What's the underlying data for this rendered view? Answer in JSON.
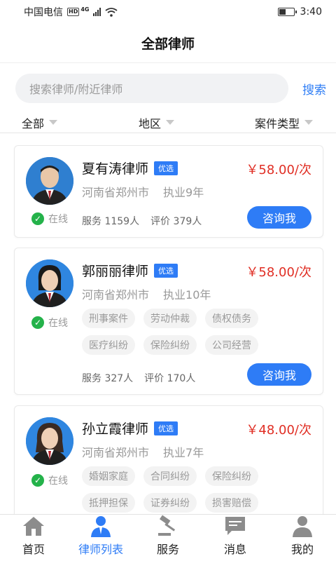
{
  "status": {
    "carrier": "中国电信",
    "hd": "HD",
    "net": "4G",
    "time": "3:40",
    "battery_level": 0.45
  },
  "header": {
    "title": "全部律师"
  },
  "search": {
    "placeholder": "搜索律师/附近律师",
    "button": "搜索"
  },
  "filters": [
    {
      "label": "全部"
    },
    {
      "label": "地区"
    },
    {
      "label": "案件类型"
    }
  ],
  "colors": {
    "accent": "#2e7cf6",
    "price": "#e02e24",
    "online": "#24b24a"
  },
  "lawyers": [
    {
      "name": "夏有涛律师",
      "badge": "优选",
      "price": "￥58.00/次",
      "location": "河南省郑州市",
      "years": "执业9年",
      "status": "在线",
      "service": "服务 1159人",
      "rating": "评价 379人",
      "button": "咨询我",
      "tags": []
    },
    {
      "name": "郭丽丽律师",
      "badge": "优选",
      "price": "￥58.00/次",
      "location": "河南省郑州市",
      "years": "执业10年",
      "status": "在线",
      "service": "服务 327人",
      "rating": "评价 170人",
      "button": "咨询我",
      "tags": [
        "刑事案件",
        "劳动仲裁",
        "债权债务",
        "医疗纠纷",
        "保险纠纷",
        "公司经营"
      ]
    },
    {
      "name": "孙立霞律师",
      "badge": "优选",
      "price": "￥48.00/次",
      "location": "河南省郑州市",
      "years": "执业7年",
      "status": "在线",
      "tags": [
        "婚姻家庭",
        "合同纠纷",
        "保险纠纷",
        "抵押担保",
        "证券纠纷",
        "损害赔偿"
      ]
    }
  ],
  "tabbar": [
    {
      "label": "首页",
      "icon": "home-icon"
    },
    {
      "label": "律师列表",
      "icon": "lawyer-icon"
    },
    {
      "label": "服务",
      "icon": "gavel-icon"
    },
    {
      "label": "消息",
      "icon": "message-icon"
    },
    {
      "label": "我的",
      "icon": "profile-icon"
    }
  ]
}
